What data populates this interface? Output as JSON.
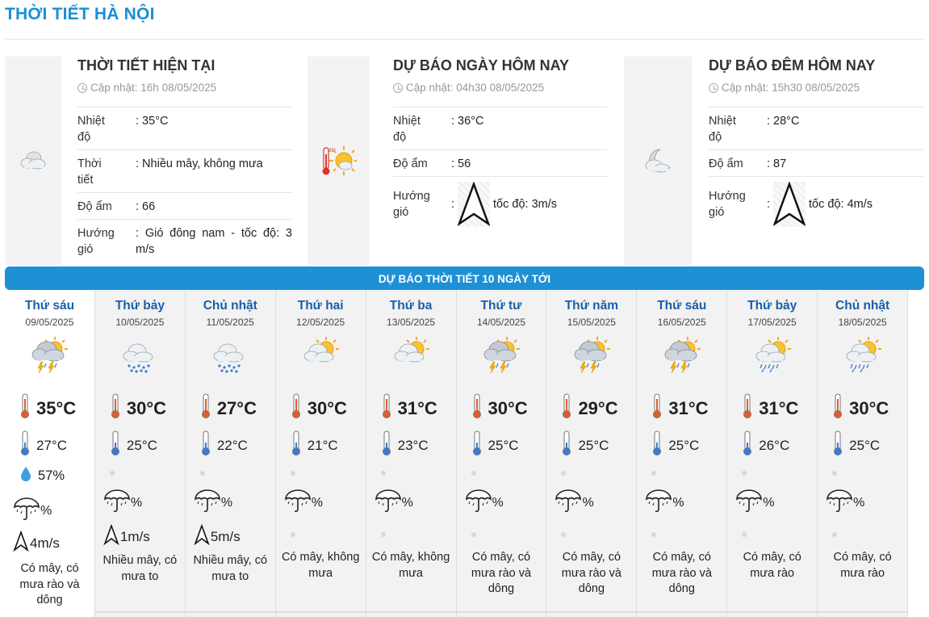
{
  "page_title": "THỜI TIẾT HÀ NỘI",
  "panels": {
    "current": {
      "title": "THỜI TIẾT HIỆN TẠI",
      "updated": "Cập nhật: 16h 08/05/2025",
      "icon": "cloudy-icon",
      "rows": [
        {
          "k": "Nhiệt độ",
          "v": ": 35°C"
        },
        {
          "k": "Thời tiết",
          "v": ": Nhiều mây, không mưa"
        },
        {
          "k": "Độ ẩm",
          "v": ": 66"
        },
        {
          "k": "Hướng gió",
          "v": ": Gió đông nam - tốc độ: 3 m/s"
        }
      ]
    },
    "today": {
      "title": "DỰ BÁO NGÀY HÔM NAY",
      "updated": "Cập nhật: 04h30 08/05/2025",
      "icon": "hot-sun-thermometer-icon",
      "rows": [
        {
          "k": "Nhiệt độ",
          "v": ": 36°C"
        },
        {
          "k": "Độ ẩm",
          "v": ": 56"
        },
        {
          "k": "Hướng gió",
          "v": ":",
          "speed": "tốc độ: 3m/s"
        }
      ]
    },
    "tonight": {
      "title": "DỰ BÁO ĐÊM HÔM NAY",
      "updated": "Cập nhật: 15h30 08/05/2025",
      "icon": "moon-cloud-icon",
      "rows": [
        {
          "k": "Nhiệt độ",
          "v": ": 28°C"
        },
        {
          "k": "Độ ẩm",
          "v": ": 87"
        },
        {
          "k": "Hướng gió",
          "v": ":",
          "speed": "tốc độ: 4m/s"
        }
      ]
    }
  },
  "banner": "DỰ BÁO THỜI TIẾT 10 NGÀY TỚI",
  "days": [
    {
      "name": "Thứ sáu",
      "date": "09/05/2025",
      "icon": "thunderstorm-sun-icon",
      "hi": "35°C",
      "lo": "27°C",
      "humidity": "57%",
      "rain": "%",
      "wind": "4m/s",
      "desc": "Có mây, có mưa rào và dông"
    },
    {
      "name": "Thứ bảy",
      "date": "10/05/2025",
      "icon": "rain-cloud-icon",
      "hi": "30°C",
      "lo": "25°C",
      "humidity": "",
      "rain": "%",
      "wind": "1m/s",
      "desc": "Nhiều mây, có mưa to"
    },
    {
      "name": "Chủ nhật",
      "date": "11/05/2025",
      "icon": "rain-cloud-icon",
      "hi": "27°C",
      "lo": "22°C",
      "humidity": "",
      "rain": "%",
      "wind": "5m/s",
      "desc": "Nhiều mây, có mưa to"
    },
    {
      "name": "Thứ hai",
      "date": "12/05/2025",
      "icon": "sun-cloud-icon",
      "hi": "30°C",
      "lo": "21°C",
      "humidity": "",
      "rain": "%",
      "wind": "",
      "desc": "Có mây, không mưa"
    },
    {
      "name": "Thứ ba",
      "date": "13/05/2025",
      "icon": "sun-cloud-icon",
      "hi": "31°C",
      "lo": "23°C",
      "humidity": "",
      "rain": "%",
      "wind": "",
      "desc": "Có mây, không mưa"
    },
    {
      "name": "Thứ tư",
      "date": "14/05/2025",
      "icon": "thunderstorm-sun-icon",
      "hi": "30°C",
      "lo": "25°C",
      "humidity": "",
      "rain": "%",
      "wind": "",
      "desc": "Có mây, có mưa rào và dông"
    },
    {
      "name": "Thứ năm",
      "date": "15/05/2025",
      "icon": "thunderstorm-sun-icon",
      "hi": "29°C",
      "lo": "25°C",
      "humidity": "",
      "rain": "%",
      "wind": "",
      "desc": "Có mây, có mưa rào và dông"
    },
    {
      "name": "Thứ sáu",
      "date": "16/05/2025",
      "icon": "thunderstorm-sun-icon",
      "hi": "31°C",
      "lo": "25°C",
      "humidity": "",
      "rain": "%",
      "wind": "",
      "desc": "Có mây, có mưa rào và dông"
    },
    {
      "name": "Thứ bảy",
      "date": "17/05/2025",
      "icon": "sun-rain-icon",
      "hi": "31°C",
      "lo": "26°C",
      "humidity": "",
      "rain": "%",
      "wind": "",
      "desc": "Có mây, có mưa rào"
    },
    {
      "name": "Chủ nhật",
      "date": "18/05/2025",
      "icon": "sun-rain-icon",
      "hi": "30°C",
      "lo": "25°C",
      "humidity": "",
      "rain": "%",
      "wind": "",
      "desc": "Có mây, có mưa rào"
    }
  ],
  "colors": {
    "accent": "#1e90d6",
    "day_name": "#1a5fa8",
    "sun": "#f5a623",
    "cloud": "#cfd6de",
    "rain": "#3a7bd5"
  }
}
